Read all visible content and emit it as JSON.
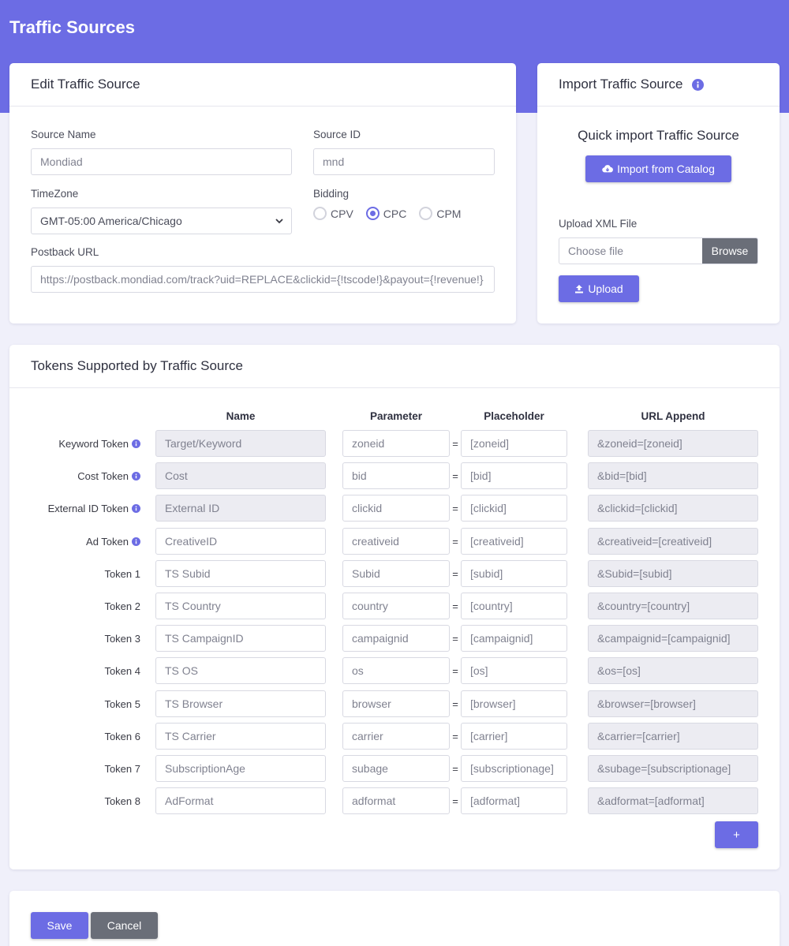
{
  "page": {
    "title": "Traffic Sources"
  },
  "colors": {
    "accent": "#6c6ce4",
    "secondary": "#6a6e78",
    "background": "#f0f0fa"
  },
  "edit": {
    "title": "Edit Traffic Source",
    "source_name": {
      "label": "Source Name",
      "placeholder": "Mondiad"
    },
    "source_id": {
      "label": "Source ID",
      "placeholder": "mnd"
    },
    "timezone": {
      "label": "TimeZone",
      "value": "GMT-05:00 America/Chicago"
    },
    "bidding": {
      "label": "Bidding",
      "options": [
        {
          "label": "CPV",
          "selected": false
        },
        {
          "label": "CPC",
          "selected": true
        },
        {
          "label": "CPM",
          "selected": false
        }
      ]
    },
    "postback": {
      "label": "Postback URL",
      "value": "https://postback.mondiad.com/track?uid=REPLACE&clickid={!tscode!}&payout={!revenue!}"
    }
  },
  "import": {
    "title": "Import Traffic Source",
    "quick_title": "Quick import Traffic Source",
    "catalog_button": "Import from Catalog",
    "upload_label": "Upload XML File",
    "file_placeholder": "Choose file",
    "browse": "Browse",
    "upload_button": "Upload"
  },
  "tokens": {
    "title": "Tokens Supported by Traffic Source",
    "headers": {
      "name": "Name",
      "parameter": "Parameter",
      "placeholder": "Placeholder",
      "append": "URL Append"
    },
    "rows": [
      {
        "label": "Keyword Token",
        "info": true,
        "name": "Target/Keyword",
        "name_ro": true,
        "param": "zoneid",
        "placeholder": "[zoneid]",
        "append": "&zoneid=[zoneid]"
      },
      {
        "label": "Cost Token",
        "info": true,
        "name": "Cost",
        "name_ro": true,
        "param": "bid",
        "placeholder": "[bid]",
        "append": "&bid=[bid]"
      },
      {
        "label": "External ID Token",
        "info": true,
        "name": "External ID",
        "name_ro": true,
        "param": "clickid",
        "placeholder": "[clickid]",
        "append": "&clickid=[clickid]"
      },
      {
        "label": "Ad Token",
        "info": true,
        "name": "CreativeID",
        "name_ro": false,
        "param": "creativeid",
        "placeholder": "[creativeid]",
        "append": "&creativeid=[creativeid]"
      },
      {
        "label": "Token 1",
        "info": false,
        "name": "TS Subid",
        "name_ro": false,
        "param": "Subid",
        "placeholder": "[subid]",
        "append": "&Subid=[subid]"
      },
      {
        "label": "Token 2",
        "info": false,
        "name": "TS Country",
        "name_ro": false,
        "param": "country",
        "placeholder": "[country]",
        "append": "&country=[country]"
      },
      {
        "label": "Token 3",
        "info": false,
        "name": "TS CampaignID",
        "name_ro": false,
        "param": "campaignid",
        "placeholder": "[campaignid]",
        "append": "&campaignid=[campaignid]"
      },
      {
        "label": "Token 4",
        "info": false,
        "name": "TS OS",
        "name_ro": false,
        "param": "os",
        "placeholder": "[os]",
        "append": "&os=[os]"
      },
      {
        "label": "Token 5",
        "info": false,
        "name": "TS Browser",
        "name_ro": false,
        "param": "browser",
        "placeholder": "[browser]",
        "append": "&browser=[browser]"
      },
      {
        "label": "Token 6",
        "info": false,
        "name": "TS Carrier",
        "name_ro": false,
        "param": "carrier",
        "placeholder": "[carrier]",
        "append": "&carrier=[carrier]"
      },
      {
        "label": "Token 7",
        "info": false,
        "name": "SubscriptionAge",
        "name_ro": false,
        "param": "subage",
        "placeholder": "[subscriptionage]",
        "append": "&subage=[subscriptionage]"
      },
      {
        "label": "Token 8",
        "info": false,
        "name": "AdFormat",
        "name_ro": false,
        "param": "adformat",
        "placeholder": "[adformat]",
        "append": "&adformat=[adformat]"
      }
    ],
    "add_button": "+",
    "equals": "="
  },
  "footer": {
    "save": "Save",
    "cancel": "Cancel"
  }
}
